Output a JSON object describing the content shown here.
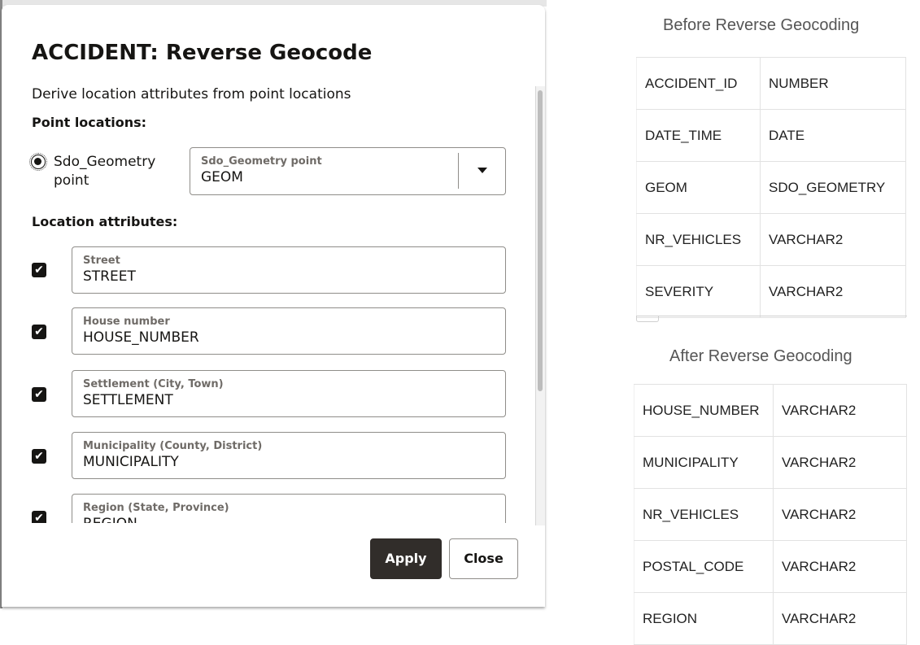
{
  "dialog": {
    "title": "ACCIDENT: Reverse Geocode",
    "description": "Derive location attributes from point locations",
    "point_locations_heading": "Point locations:",
    "radio_label": "Sdo_Geometry point",
    "geometry_select": {
      "label": "Sdo_Geometry point",
      "value": "GEOM"
    },
    "location_attributes_heading": "Location attributes:",
    "attributes": [
      {
        "label": "Street",
        "value": "STREET",
        "checked": true
      },
      {
        "label": "House number",
        "value": "HOUSE_NUMBER",
        "checked": true
      },
      {
        "label": "Settlement (City, Town)",
        "value": "SETTLEMENT",
        "checked": true
      },
      {
        "label": "Municipality (County, District)",
        "value": "MUNICIPALITY",
        "checked": true
      },
      {
        "label": "Region (State, Province)",
        "value": "REGION",
        "checked": true
      }
    ],
    "apply_label": "Apply",
    "close_label": "Close"
  },
  "before": {
    "title": "Before Reverse Geocoding",
    "rows": [
      [
        "ACCIDENT_ID",
        "NUMBER"
      ],
      [
        "DATE_TIME",
        "DATE"
      ],
      [
        "GEOM",
        "SDO_GEOMETRY"
      ],
      [
        "NR_VEHICLES",
        "VARCHAR2"
      ],
      [
        "SEVERITY",
        "VARCHAR2"
      ]
    ]
  },
  "after": {
    "title": "After Reverse Geocoding",
    "rows": [
      [
        "HOUSE_NUMBER",
        "VARCHAR2"
      ],
      [
        "MUNICIPALITY",
        "VARCHAR2"
      ],
      [
        "NR_VEHICLES",
        "VARCHAR2"
      ],
      [
        "POSTAL_CODE",
        "VARCHAR2"
      ],
      [
        "REGION",
        "VARCHAR2"
      ]
    ]
  },
  "icons": {
    "checkbox": "checkmark-icon",
    "select": "chevron-down-icon"
  }
}
